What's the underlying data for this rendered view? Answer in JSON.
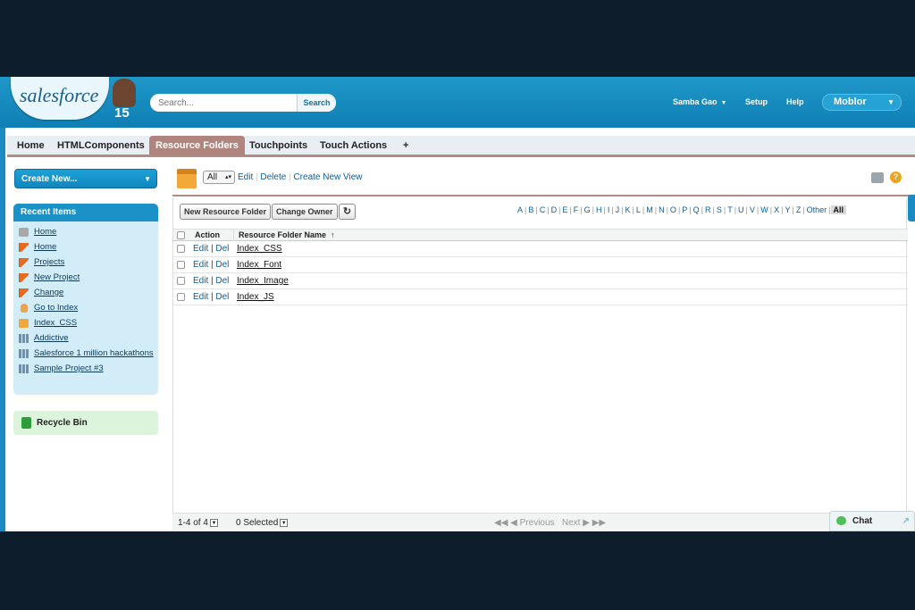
{
  "header": {
    "logo_text": "salesforce",
    "logo_number": "15",
    "search_placeholder": "Search...",
    "search_button": "Search",
    "user_name": "Samba Gao",
    "setup": "Setup",
    "help": "Help",
    "app_menu": "Moblor"
  },
  "tabs": [
    "Home",
    "HTMLComponents",
    "Resource Folders",
    "Touchpoints",
    "Touch Actions",
    "+"
  ],
  "active_tab": "Resource Folders",
  "sidebar": {
    "create_new": "Create New...",
    "recent_items_title": "Recent Items",
    "recent_items": [
      {
        "label": "Home",
        "icon": "wrench-icon"
      },
      {
        "label": "Home",
        "icon": "flag-icon"
      },
      {
        "label": "Projects",
        "icon": "flag-icon"
      },
      {
        "label": "New Project",
        "icon": "flag-icon"
      },
      {
        "label": "Change",
        "icon": "flag-icon"
      },
      {
        "label": "Go to Index",
        "icon": "hand-icon"
      },
      {
        "label": "Index_CSS",
        "icon": "box-icon"
      },
      {
        "label": "Addictive",
        "icon": "chart-icon"
      },
      {
        "label": "Salesforce 1 million hackathons",
        "icon": "chart-icon"
      },
      {
        "label": "Sample Project #3",
        "icon": "chart-icon"
      }
    ],
    "recycle_bin": "Recycle Bin"
  },
  "view": {
    "selected": "All",
    "edit": "Edit",
    "delete": "Delete",
    "create_new_view": "Create New View"
  },
  "list": {
    "new_button": "New Resource Folder",
    "change_owner_button": "Change Owner",
    "refresh_glyph": "↻",
    "alphabet": [
      "A",
      "B",
      "C",
      "D",
      "E",
      "F",
      "G",
      "H",
      "I",
      "J",
      "K",
      "L",
      "M",
      "N",
      "O",
      "P",
      "Q",
      "R",
      "S",
      "T",
      "U",
      "V",
      "W",
      "X",
      "Y",
      "Z",
      "Other",
      "All"
    ],
    "alphabet_selected": "All",
    "columns": {
      "action": "Action",
      "name": "Resource Folder Name",
      "sort": "↑"
    },
    "rows": [
      {
        "edit": "Edit",
        "del": "Del",
        "name": "Index_CSS"
      },
      {
        "edit": "Edit",
        "del": "Del",
        "name": "Index_Font"
      },
      {
        "edit": "Edit",
        "del": "Del",
        "name": "Index_Image"
      },
      {
        "edit": "Edit",
        "del": "Del",
        "name": "Index_JS"
      }
    ]
  },
  "footer": {
    "count": "1-4 of 4",
    "selected": "0 Selected",
    "previous": "◀◀ ◀ Previous",
    "next": "Next ▶ ▶▶"
  },
  "chat": {
    "label": "Chat"
  },
  "colors": {
    "header_blue": "#1a8bc0",
    "active_tab": "#b0857e",
    "link": "#0b5d9b"
  }
}
